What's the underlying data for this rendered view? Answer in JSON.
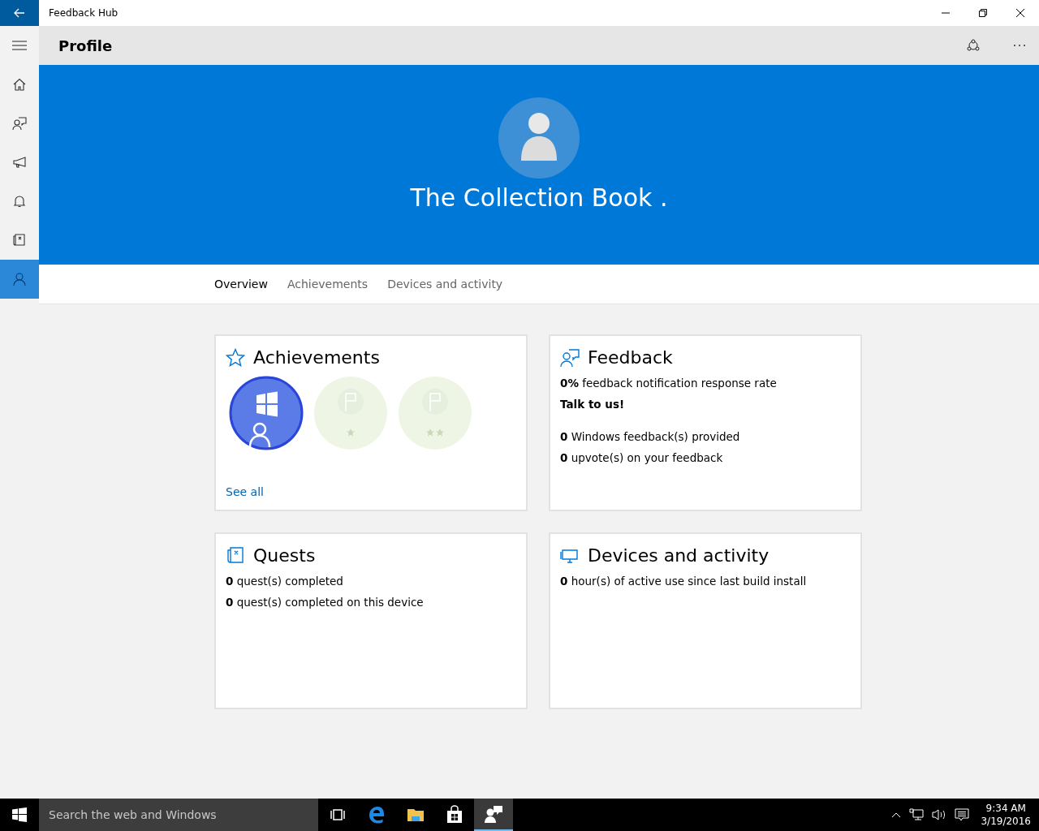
{
  "window": {
    "title": "Feedback Hub"
  },
  "nav": [
    {
      "kind": "home",
      "selected": false
    },
    {
      "kind": "feedback",
      "selected": false
    },
    {
      "kind": "announce",
      "selected": false
    },
    {
      "kind": "bell",
      "selected": false
    },
    {
      "kind": "quest",
      "selected": false
    },
    {
      "kind": "profile",
      "selected": true
    }
  ],
  "header": {
    "title": "Profile"
  },
  "profile": {
    "name": "The Collection Book ."
  },
  "tabs": [
    {
      "label": "Overview",
      "selected": true
    },
    {
      "label": "Achievements",
      "selected": false
    },
    {
      "label": "Devices and activity",
      "selected": false
    }
  ],
  "cards": [
    {
      "kind": "achievements",
      "title": "Achievements",
      "badges": [
        {
          "kind": "windows",
          "earned": true
        },
        {
          "kind": "one_star",
          "earned": false
        },
        {
          "kind": "two_star",
          "earned": false
        }
      ],
      "link": "See all"
    },
    {
      "kind": "feedback",
      "title": "Feedback",
      "lines": [
        {
          "text": "**0%** feedback notification response rate"
        },
        {
          "text": "**Talk to us!**"
        },
        {
          "text": "**0** Windows feedback(s) provided",
          "gap_before": true
        },
        {
          "text": "**0** upvote(s) on your feedback"
        }
      ]
    },
    {
      "kind": "quests",
      "title": "Quests",
      "lines": [
        {
          "text": "**0** quest(s) completed"
        },
        {
          "text": "**0** quest(s) completed on this device"
        }
      ]
    },
    {
      "kind": "devices",
      "title": "Devices and activity",
      "lines": [
        {
          "text": "**0** hour(s) of active use since last build install"
        }
      ]
    }
  ],
  "taskbar": {
    "search_placeholder": "Search the web and Windows",
    "apps": [
      {
        "kind": "taskview",
        "selected": false
      },
      {
        "kind": "edge",
        "selected": false
      },
      {
        "kind": "explorer",
        "selected": false
      },
      {
        "kind": "store",
        "selected": false
      },
      {
        "kind": "feedback",
        "selected": true
      }
    ],
    "time": "9:34 AM",
    "date": "3/19/2016"
  }
}
